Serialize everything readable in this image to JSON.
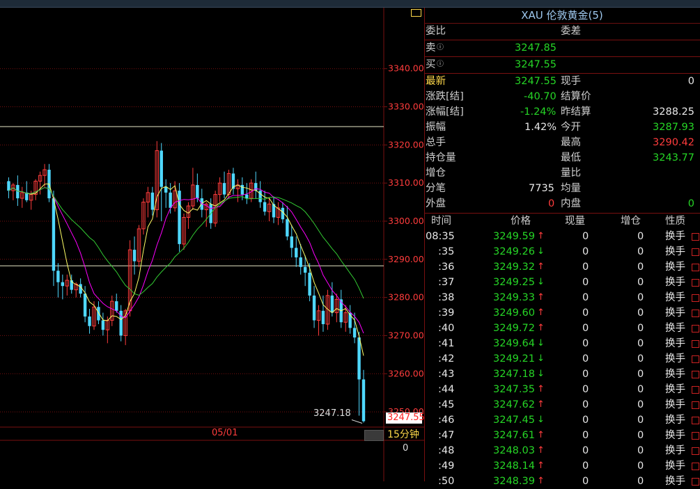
{
  "instrument_title": "XAU 伦敦黄金(5)",
  "order_book": {
    "ratio_label": "委比",
    "diff_label": "委差",
    "sell_label": "卖",
    "sell_price": "3247.85",
    "buy_label": "买",
    "buy_price": "3247.55"
  },
  "quote": {
    "latest_label": "最新",
    "latest_value": "3247.55",
    "current_hand_label": "现手",
    "current_hand_value": "0",
    "change_label": "涨跌[结]",
    "change_value": "-40.70",
    "settle_label": "结算价",
    "settle_value": "",
    "change_pct_label": "涨幅[结]",
    "change_pct_value": "-1.24%",
    "prev_settle_label": "昨结算",
    "prev_settle_value": "3288.25",
    "amplitude_label": "振幅",
    "amplitude_value": "1.42%",
    "open_label": "今开",
    "open_value": "3287.93",
    "total_hand_label": "总手",
    "total_hand_value": "",
    "high_label": "最高",
    "high_value": "3290.42",
    "position_label": "持仓量",
    "position_value": "",
    "low_label": "最低",
    "low_value": "3243.77",
    "increase_label": "增仓",
    "increase_value": "",
    "volume_ratio_label": "量比",
    "volume_ratio_value": "",
    "ticks_label": "分笔",
    "ticks_value": "7735",
    "avg_label": "均量",
    "avg_value": "",
    "outer_label": "外盘",
    "outer_value": "0",
    "inner_label": "内盘",
    "inner_value": "0"
  },
  "ticks_table": {
    "headers": [
      "时间",
      "价格",
      "现量",
      "增仓",
      "性质"
    ],
    "rows": [
      {
        "time": "08:35",
        "price": "3249.59",
        "dir": "up",
        "vol": "0",
        "inc": "0",
        "type": "换手"
      },
      {
        "time": ":35",
        "price": "3249.26",
        "dir": "down",
        "vol": "0",
        "inc": "0",
        "type": "换手"
      },
      {
        "time": ":36",
        "price": "3249.32",
        "dir": "up",
        "vol": "0",
        "inc": "0",
        "type": "换手"
      },
      {
        "time": ":37",
        "price": "3249.25",
        "dir": "down",
        "vol": "0",
        "inc": "0",
        "type": "换手"
      },
      {
        "time": ":38",
        "price": "3249.33",
        "dir": "up",
        "vol": "0",
        "inc": "0",
        "type": "换手"
      },
      {
        "time": ":39",
        "price": "3249.60",
        "dir": "up",
        "vol": "0",
        "inc": "0",
        "type": "换手"
      },
      {
        "time": ":40",
        "price": "3249.72",
        "dir": "up",
        "vol": "0",
        "inc": "0",
        "type": "换手"
      },
      {
        "time": ":41",
        "price": "3249.64",
        "dir": "down",
        "vol": "0",
        "inc": "0",
        "type": "换手"
      },
      {
        "time": ":42",
        "price": "3249.21",
        "dir": "down",
        "vol": "0",
        "inc": "0",
        "type": "换手"
      },
      {
        "time": ":43",
        "price": "3247.18",
        "dir": "down",
        "vol": "0",
        "inc": "0",
        "type": "换手"
      },
      {
        "time": ":44",
        "price": "3247.35",
        "dir": "up",
        "vol": "0",
        "inc": "0",
        "type": "换手"
      },
      {
        "time": ":45",
        "price": "3247.62",
        "dir": "up",
        "vol": "0",
        "inc": "0",
        "type": "换手"
      },
      {
        "time": ":46",
        "price": "3247.45",
        "dir": "down",
        "vol": "0",
        "inc": "0",
        "type": "换手"
      },
      {
        "time": ":47",
        "price": "3247.61",
        "dir": "up",
        "vol": "0",
        "inc": "0",
        "type": "换手"
      },
      {
        "time": ":48",
        "price": "3248.03",
        "dir": "up",
        "vol": "0",
        "inc": "0",
        "type": "换手"
      },
      {
        "time": ":49",
        "price": "3248.14",
        "dir": "up",
        "vol": "0",
        "inc": "0",
        "type": "换手"
      },
      {
        "time": ":50",
        "price": "3248.39",
        "dir": "up",
        "vol": "0",
        "inc": "0",
        "type": "换手"
      }
    ]
  },
  "chart_data": {
    "type": "candlestick",
    "period_label": "15分钟",
    "date_label": "05/01",
    "bottom_value_label": "0",
    "y_ticks": [
      "3340.00",
      "3330.00",
      "3320.00",
      "3310.00",
      "3300.00",
      "3290.00",
      "3280.00",
      "3270.00",
      "3260.00",
      "3250.00"
    ],
    "ylim": [
      3246.0,
      3356.0
    ],
    "last_price_label": "3247.55",
    "last_low_label": "3247.18",
    "horizontal_levels": [
      3324.8,
      3288.3
    ],
    "candles": [
      [
        3310.5,
        3311.5,
        3306.0,
        3308.0
      ],
      [
        3308.0,
        3310.0,
        3305.5,
        3309.5
      ],
      [
        3309.5,
        3312.0,
        3304.0,
        3306.0
      ],
      [
        3306.0,
        3309.0,
        3303.5,
        3307.5
      ],
      [
        3307.5,
        3310.5,
        3305.0,
        3305.5
      ],
      [
        3305.5,
        3308.0,
        3303.0,
        3307.0
      ],
      [
        3307.0,
        3311.0,
        3305.5,
        3310.5
      ],
      [
        3310.5,
        3313.0,
        3307.0,
        3312.0
      ],
      [
        3312.0,
        3315.0,
        3309.0,
        3313.5
      ],
      [
        3313.5,
        3315.0,
        3305.0,
        3306.0
      ],
      [
        3306.0,
        3308.0,
        3283.0,
        3287.0
      ],
      [
        3287.0,
        3289.0,
        3280.0,
        3284.0
      ],
      [
        3284.0,
        3286.0,
        3279.5,
        3283.0
      ],
      [
        3283.0,
        3286.0,
        3280.5,
        3284.5
      ],
      [
        3284.5,
        3286.0,
        3281.0,
        3282.0
      ],
      [
        3282.0,
        3284.0,
        3280.0,
        3283.5
      ],
      [
        3283.5,
        3285.0,
        3280.0,
        3281.0
      ],
      [
        3281.0,
        3283.0,
        3273.5,
        3275.0
      ],
      [
        3275.0,
        3277.0,
        3270.5,
        3272.5
      ],
      [
        3272.5,
        3279.0,
        3271.5,
        3277.5
      ],
      [
        3277.5,
        3279.0,
        3273.0,
        3274.0
      ],
      [
        3274.0,
        3276.0,
        3270.0,
        3271.5
      ],
      [
        3271.5,
        3275.0,
        3268.0,
        3274.0
      ],
      [
        3274.0,
        3280.5,
        3272.5,
        3279.0
      ],
      [
        3279.0,
        3281.0,
        3276.0,
        3276.5
      ],
      [
        3276.5,
        3278.0,
        3268.5,
        3270.0
      ],
      [
        3270.0,
        3277.0,
        3267.5,
        3276.5
      ],
      [
        3276.5,
        3295.0,
        3275.0,
        3292.5
      ],
      [
        3292.5,
        3296.0,
        3286.0,
        3289.5
      ],
      [
        3289.5,
        3299.0,
        3288.0,
        3298.0
      ],
      [
        3298.0,
        3306.0,
        3296.5,
        3305.0
      ],
      [
        3305.0,
        3309.0,
        3301.0,
        3307.5
      ],
      [
        3307.5,
        3309.0,
        3301.5,
        3303.0
      ],
      [
        3303.0,
        3321.0,
        3301.0,
        3318.5
      ],
      [
        3318.5,
        3320.5,
        3300.0,
        3309.0
      ],
      [
        3309.0,
        3311.0,
        3303.5,
        3307.5
      ],
      [
        3307.5,
        3310.0,
        3302.0,
        3303.5
      ],
      [
        3303.5,
        3310.5,
        3302.5,
        3308.0
      ],
      [
        3308.0,
        3310.0,
        3292.0,
        3294.0
      ],
      [
        3294.0,
        3302.0,
        3292.5,
        3301.0
      ],
      [
        3301.0,
        3305.0,
        3298.0,
        3304.0
      ],
      [
        3304.0,
        3314.0,
        3303.0,
        3309.5
      ],
      [
        3309.5,
        3312.5,
        3305.0,
        3306.0
      ],
      [
        3306.0,
        3308.5,
        3301.0,
        3303.0
      ],
      [
        3303.0,
        3305.0,
        3298.5,
        3304.5
      ],
      [
        3304.5,
        3306.0,
        3298.0,
        3299.5
      ],
      [
        3299.5,
        3308.0,
        3298.5,
        3307.0
      ],
      [
        3307.0,
        3311.5,
        3305.0,
        3310.0
      ],
      [
        3310.0,
        3313.0,
        3306.0,
        3307.0
      ],
      [
        3307.0,
        3313.5,
        3306.0,
        3312.5
      ],
      [
        3312.5,
        3314.0,
        3307.0,
        3308.5
      ],
      [
        3308.5,
        3311.0,
        3305.0,
        3309.5
      ],
      [
        3309.5,
        3311.5,
        3305.5,
        3307.0
      ],
      [
        3307.0,
        3310.0,
        3304.5,
        3306.0
      ],
      [
        3306.0,
        3311.0,
        3305.0,
        3310.0
      ],
      [
        3310.0,
        3313.0,
        3306.0,
        3308.0
      ],
      [
        3308.0,
        3310.5,
        3303.5,
        3305.0
      ],
      [
        3305.0,
        3308.0,
        3301.5,
        3302.5
      ],
      [
        3302.5,
        3306.0,
        3300.0,
        3304.5
      ],
      [
        3304.5,
        3306.5,
        3299.5,
        3301.0
      ],
      [
        3301.0,
        3305.0,
        3299.0,
        3303.5
      ],
      [
        3303.5,
        3305.0,
        3299.5,
        3300.5
      ],
      [
        3300.5,
        3304.0,
        3295.0,
        3296.0
      ],
      [
        3296.0,
        3299.0,
        3290.5,
        3293.0
      ],
      [
        3293.0,
        3296.0,
        3288.0,
        3290.5
      ],
      [
        3290.5,
        3294.0,
        3286.0,
        3288.0
      ],
      [
        3288.0,
        3291.0,
        3283.0,
        3286.5
      ],
      [
        3286.5,
        3289.0,
        3279.0,
        3280.5
      ],
      [
        3280.5,
        3283.0,
        3272.0,
        3274.0
      ],
      [
        3274.0,
        3278.0,
        3270.0,
        3276.5
      ],
      [
        3276.5,
        3280.5,
        3271.0,
        3273.0
      ],
      [
        3273.0,
        3282.0,
        3271.5,
        3280.5
      ],
      [
        3280.5,
        3284.0,
        3275.0,
        3276.0
      ],
      [
        3276.0,
        3281.0,
        3273.5,
        3279.5
      ],
      [
        3279.5,
        3282.0,
        3272.0,
        3273.5
      ],
      [
        3273.5,
        3278.0,
        3271.0,
        3276.0
      ],
      [
        3276.0,
        3278.0,
        3270.5,
        3272.0
      ],
      [
        3272.0,
        3276.0,
        3268.0,
        3269.5
      ],
      [
        3269.5,
        3271.0,
        3249.0,
        3258.5
      ],
      [
        3258.5,
        3261.0,
        3247.18,
        3247.55
      ]
    ],
    "ma_series": [
      {
        "color": "#ffff66"
      },
      {
        "color": "#ff00ff"
      },
      {
        "color": "#33cc33"
      }
    ],
    "colors": {
      "up": "#ff3c3c",
      "down": "#4fd8ff",
      "grid": "#7a1010",
      "axis_text": "#ff3c3c"
    }
  }
}
